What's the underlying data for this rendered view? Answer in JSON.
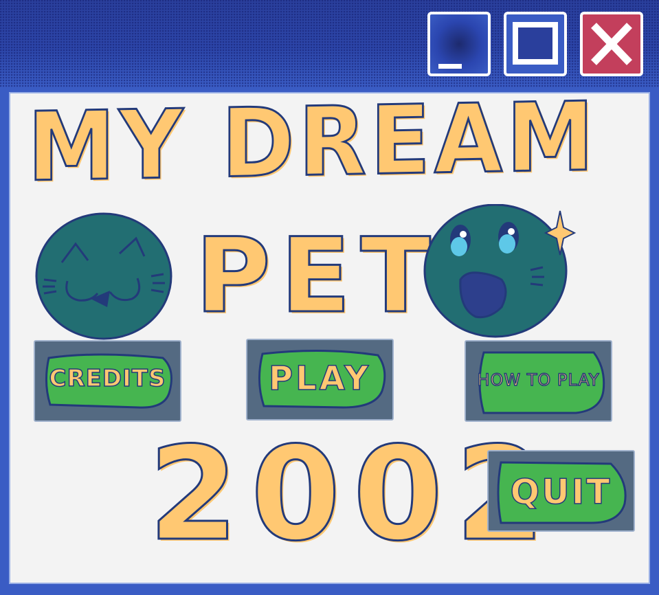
{
  "window": {
    "title_bar_buttons": [
      {
        "name": "minimize",
        "icon": "minimize-icon"
      },
      {
        "name": "maximize",
        "icon": "maximize-icon"
      },
      {
        "name": "close",
        "icon": "close-icon"
      }
    ],
    "colors": {
      "frame": "#3a5cc4",
      "close": "#c33f5c",
      "content": "#f3f3f3"
    }
  },
  "title": {
    "line1": "MY DREAM",
    "line2": "PET",
    "year": "2002"
  },
  "menu": {
    "credits_label": "CREDITS",
    "play_label": "PLAY",
    "howto_label": "HOW TO PLAY",
    "quit_label": "QUIT"
  },
  "colors": {
    "lettering": "#ffc872",
    "outline": "#233a7a",
    "button_bg": "#546a82",
    "button_pill": "#46b550",
    "pet_body": "#226e72"
  }
}
